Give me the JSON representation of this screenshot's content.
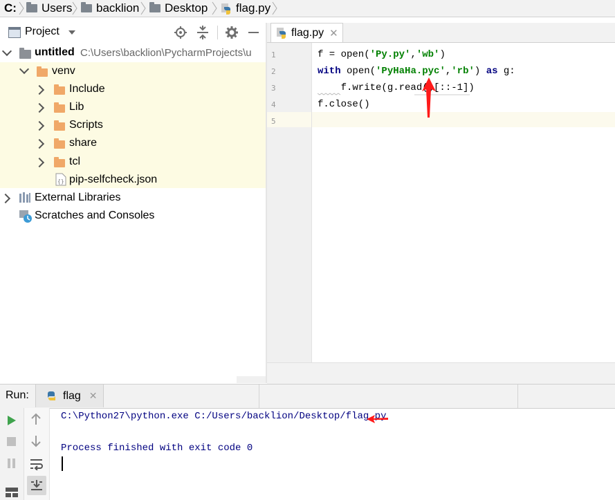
{
  "breadcrumb": {
    "items": [
      "C:",
      "Users",
      "backlion",
      "Desktop",
      "flag.py"
    ]
  },
  "project_panel": {
    "title": "Project",
    "tree": [
      {
        "label": "untitled",
        "path": "C:\\Users\\backlion\\PycharmProjects\\u"
      },
      {
        "label": "venv"
      },
      {
        "label": "Include"
      },
      {
        "label": "Lib"
      },
      {
        "label": "Scripts"
      },
      {
        "label": "share"
      },
      {
        "label": "tcl"
      },
      {
        "label": "pip-selfcheck.json"
      },
      {
        "label": "External Libraries"
      },
      {
        "label": "Scratches and Consoles"
      }
    ]
  },
  "editor": {
    "tab_label": "flag.py",
    "line_numbers": [
      "1",
      "2",
      "3",
      "4",
      "5"
    ],
    "lines": [
      [
        "f = open(",
        "'Py.py'",
        ",",
        "'wb'",
        ")"
      ],
      [
        "with",
        " open(",
        "'PyHaHa.pyc'",
        ",",
        "'rb'",
        ") ",
        "as",
        " g:"
      ],
      [
        "    f.write(g.read()[::-1])"
      ],
      [
        "f.close()"
      ],
      [
        ""
      ]
    ]
  },
  "run_panel": {
    "label": "Run:",
    "tab_label": "flag",
    "output": [
      "C:\\Python27\\python.exe C:/Users/backlion/Desktop/flag.py",
      "",
      "Process finished with exit code 0"
    ]
  },
  "colors": {
    "keyword": "#000080",
    "string": "#008000",
    "console_text": "#000080",
    "folder": "#f0a868",
    "highlight_row": "#fdfbe3",
    "annotation_arrow": "#ff1a1a"
  }
}
